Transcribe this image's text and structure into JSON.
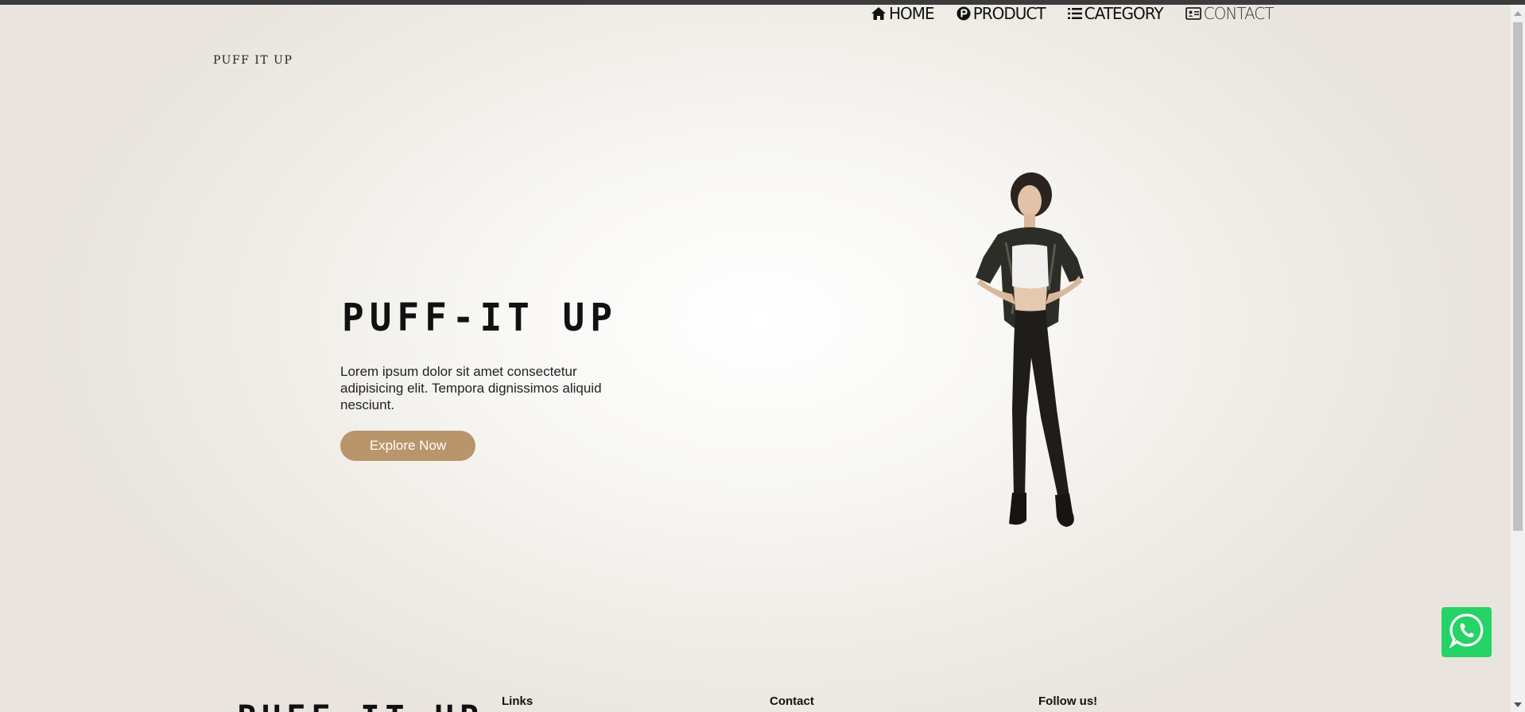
{
  "nav": {
    "items": [
      {
        "label": "HOME",
        "icon": "home-icon"
      },
      {
        "label": "PRODUCT",
        "icon": "product-p-icon"
      },
      {
        "label": "CATEGORY",
        "icon": "list-icon"
      },
      {
        "label": "CONTACT",
        "icon": "contact-card-icon"
      }
    ]
  },
  "brand": {
    "small_logo": "PUFF IT UP"
  },
  "hero": {
    "title": "PUFF-IT UP",
    "description": "Lorem ipsum dolor sit amet consectetur adipisicing elit. Tempora dignissimos aliquid nesciunt.",
    "cta_label": "Explore Now",
    "image": "model-photo"
  },
  "footer": {
    "logo": "PUFF-IT UP",
    "headings": [
      "Links",
      "Contact",
      "Follow us!"
    ]
  },
  "colors": {
    "accent": "#b8956a",
    "whatsapp": "#25d366",
    "text": "#111111"
  },
  "floating": {
    "whatsapp_icon": "whatsapp-icon"
  }
}
